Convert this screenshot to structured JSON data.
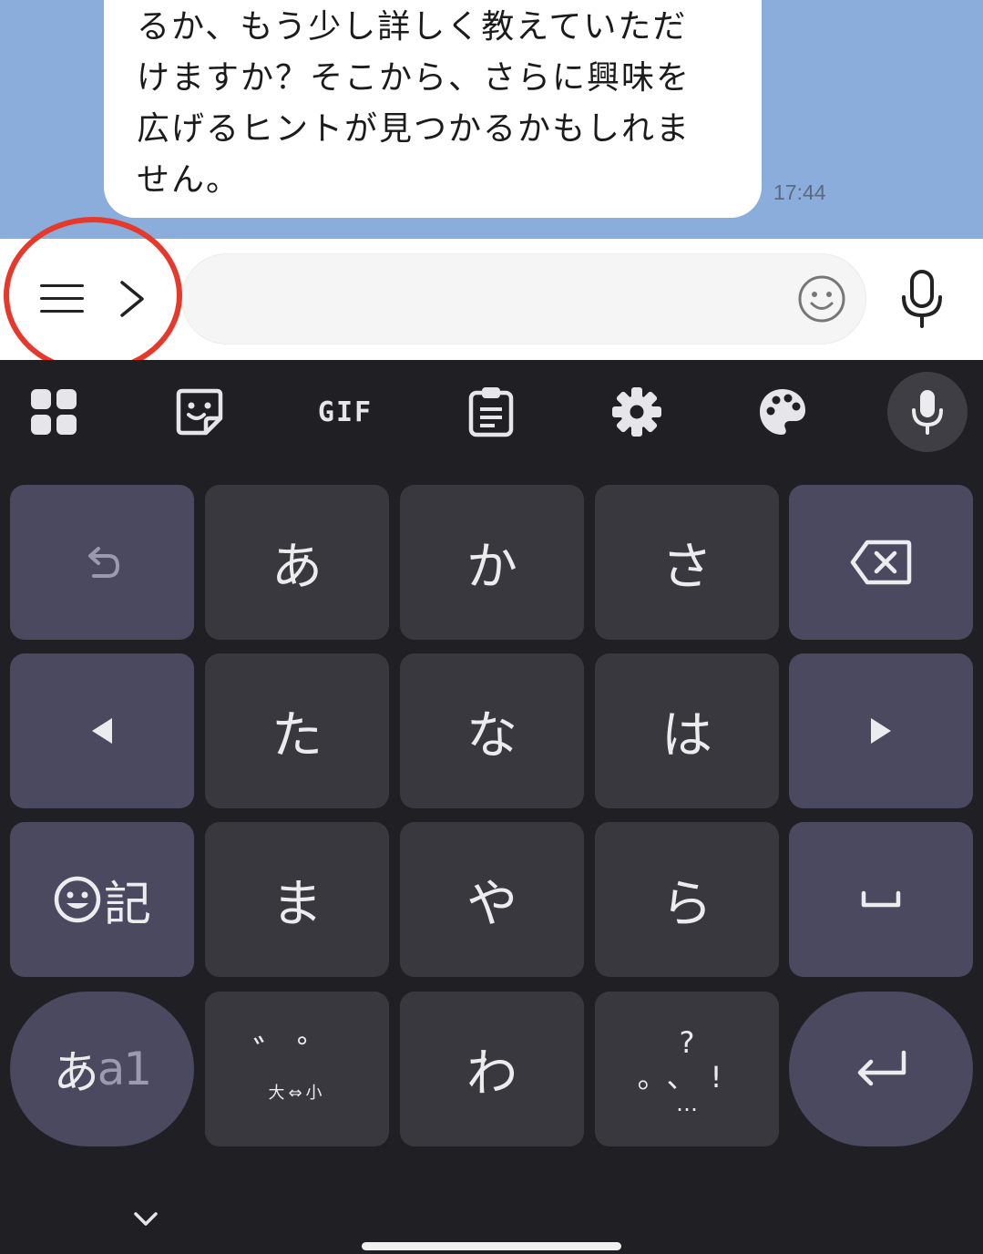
{
  "chat": {
    "message_lines": [
      "るか、もう少し詳しく教えていただ",
      "けますか？そこから、さらに興味を",
      "広げるヒントが見つかるかもしれま",
      "せん。"
    ],
    "timestamp": "17:44"
  },
  "input_bar": {
    "message_value": "",
    "icons": [
      "menu-icon",
      "chevron-right-icon",
      "smiley-icon",
      "microphone-icon"
    ]
  },
  "highlight": {
    "color": "#e6392c"
  },
  "keyboard": {
    "toolbar": {
      "gif_label": "GIF",
      "icons": [
        "apps-grid-icon",
        "sticker-icon",
        "gif-icon",
        "clipboard-icon",
        "settings-gear-icon",
        "palette-icon",
        "voice-input-icon"
      ]
    },
    "keys": {
      "a": "あ",
      "ka": "か",
      "sa": "さ",
      "ta": "た",
      "na": "な",
      "ha": "は",
      "ma": "ま",
      "ya": "や",
      "ra": "ら",
      "wa": "わ",
      "kigo_label": "記",
      "mode_kana": "あ",
      "mode_alpha": "a1",
      "dakuten_top": "゛゜",
      "dakuten_bottom": "大⇔小",
      "punct_top": "?",
      "punct_mid": "。、!",
      "punct_dots": "…"
    },
    "colors": {
      "background": "#202024",
      "key": "#38383e",
      "function_key": "#4a4960",
      "chat_background": "#8aaddb"
    }
  }
}
